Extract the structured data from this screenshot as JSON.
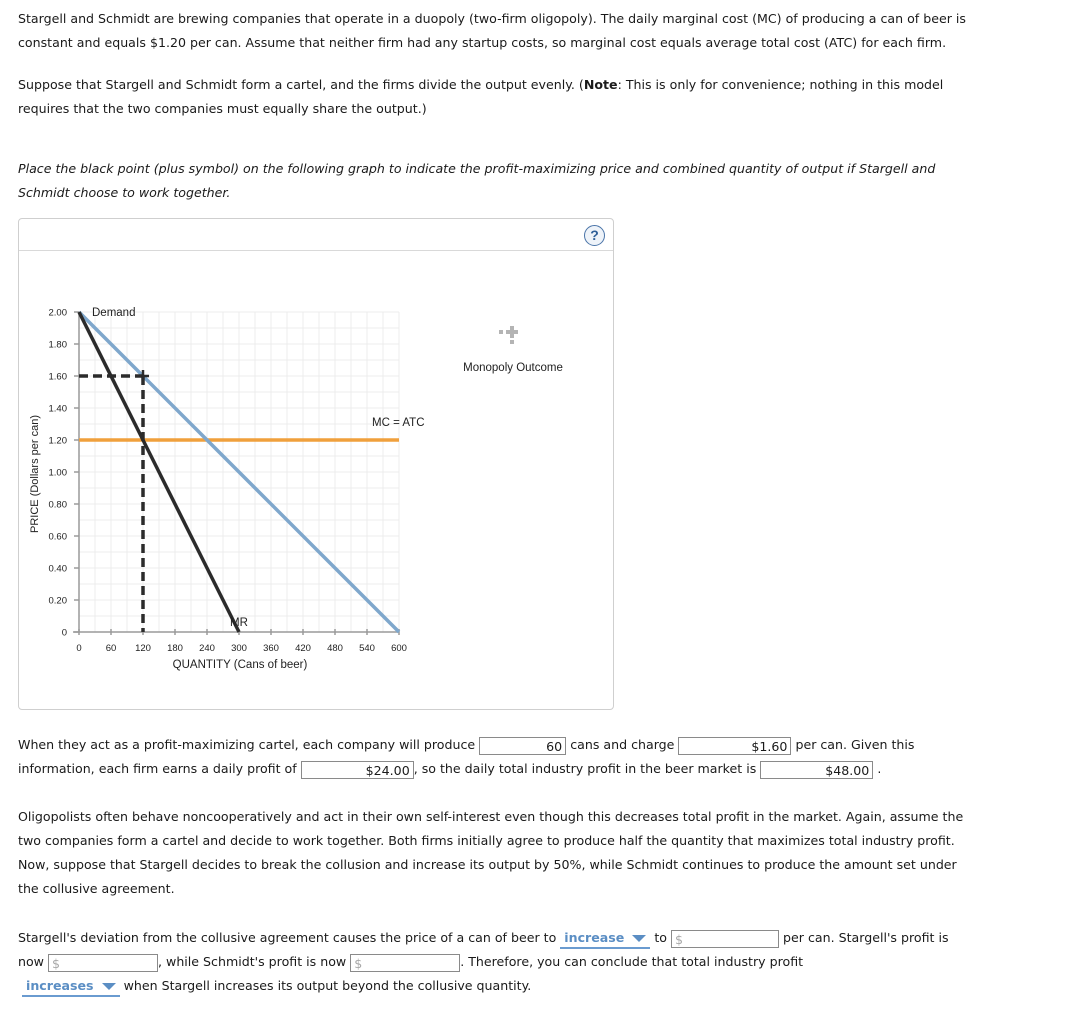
{
  "intro": {
    "line1": "Stargell and Schmidt are brewing companies that operate in a duopoly (two-firm oligopoly). The daily marginal cost (MC) of producing a can of beer is",
    "line2": "constant and equals $1.20 per can. Assume that neither firm had any startup costs, so marginal cost equals average total cost (ATC) for each firm."
  },
  "cartel_para": {
    "line1_pre": "Suppose that Stargell and Schmidt form a cartel, and the firms divide the output evenly. (",
    "note_bold": "Note",
    "line1_post": ": This is only for convenience; nothing in this model",
    "line2": "requires that the two companies must equally share the output.)"
  },
  "instruction": {
    "line1": "Place the black point (plus symbol) on the following graph to indicate the profit-maximizing price and combined quantity of output if Stargell and",
    "line2": "Schmidt choose to work together."
  },
  "graph": {
    "help_label": "?",
    "palette_label": "Monopoly Outcome",
    "colors": {
      "demand": "#7fa7cc",
      "mr": "#2b2b2b",
      "mc": "#f0a03c",
      "grid": "#ececec",
      "axis": "#9a9a9a",
      "palette": "#b4b4b4"
    }
  },
  "chart_data": {
    "type": "line",
    "title": "",
    "xlabel": "QUANTITY (Cans of beer)",
    "ylabel": "PRICE (Dollars per can)",
    "xlim": [
      0,
      600
    ],
    "ylim": [
      0,
      2.0
    ],
    "x_ticks": [
      0,
      60,
      120,
      180,
      240,
      300,
      360,
      420,
      480,
      540,
      600
    ],
    "x_tick_labels": [
      "0",
      "60",
      "120",
      "180",
      "240",
      "300",
      "360",
      "420",
      "480",
      "540",
      "600"
    ],
    "y_ticks": [
      0,
      0.2,
      0.4,
      0.6,
      0.8,
      1.0,
      1.2,
      1.4,
      1.6,
      1.8,
      2.0
    ],
    "y_tick_labels": [
      "0",
      "0.20",
      "0.40",
      "0.60",
      "0.80",
      "1.00",
      "1.20",
      "1.40",
      "1.60",
      "1.80",
      "2.00"
    ],
    "grid": true,
    "series": [
      {
        "name": "Demand",
        "points": [
          [
            0,
            2.0
          ],
          [
            600,
            0
          ]
        ]
      },
      {
        "name": "MR",
        "points": [
          [
            0,
            2.0
          ],
          [
            300,
            0
          ]
        ]
      },
      {
        "name": "MC = ATC",
        "points": [
          [
            0,
            1.2
          ],
          [
            600,
            1.2
          ]
        ]
      }
    ],
    "placed_point": {
      "name": "Monopoly Outcome",
      "x": 120,
      "y": 1.6
    }
  },
  "answers1": {
    "t1": "When they act as a profit-maximizing cartel, each company will produce",
    "qty": "60",
    "t2": "cans and charge",
    "price": "$1.60",
    "t3": "per can. Given this",
    "t4": "information, each firm earns a daily profit of",
    "profit_each": "$24.00",
    "t5": ", so the daily total industry profit in the beer market is",
    "profit_total": "$48.00",
    "t6": "."
  },
  "oligopoly_para": {
    "line1": "Oligopolists often behave noncooperatively and act in their own self-interest even though this decreases total profit in the market. Again, assume the",
    "line2": "two companies form a cartel and decide to work together. Both firms initially agree to produce half the quantity that maximizes total industry profit.",
    "line3": "Now, suppose that Stargell decides to break the collusion and increase its output by 50%, while Schmidt continues to produce the amount set under",
    "line4": "the collusive agreement."
  },
  "answers2": {
    "t1": "Stargell's deviation from the collusive agreement causes the price of a can of beer to",
    "price_direction": "increase",
    "t2": "to",
    "price_placeholder": "$",
    "t3": "per can. Stargell's profit is",
    "t4": "now",
    "stargell_placeholder": "$",
    "t5": ", while Schmidt's profit is now",
    "schmidt_placeholder": "$",
    "t6": ". Therefore, you can conclude that total industry profit",
    "profit_direction": "increases",
    "t7": "when Stargell increases its output beyond the collusive quantity."
  }
}
